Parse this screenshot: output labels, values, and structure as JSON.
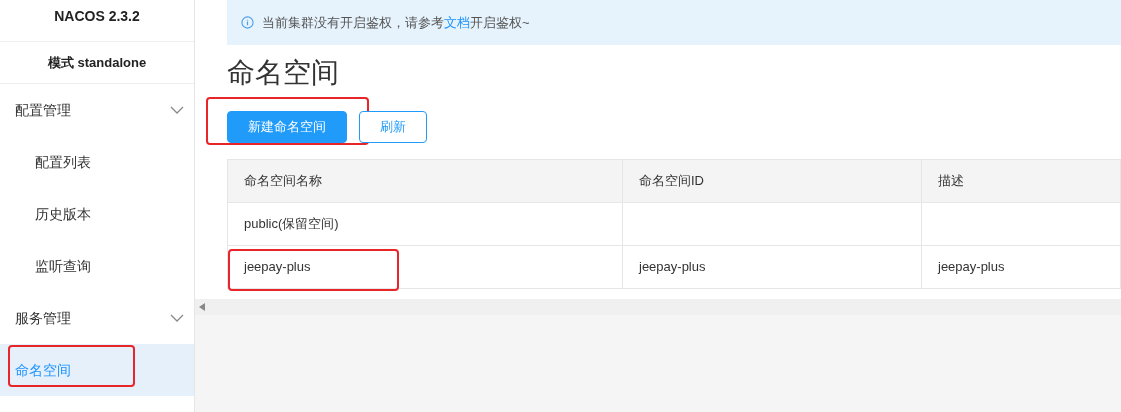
{
  "sidebar": {
    "title": "NACOS 2.3.2",
    "mode": "模式 standalone",
    "groups": [
      {
        "label": "配置管理",
        "items": [
          {
            "label": "配置列表",
            "selected": false,
            "highlighted": false
          },
          {
            "label": "历史版本",
            "selected": false,
            "highlighted": false
          },
          {
            "label": "监听查询",
            "selected": false,
            "highlighted": false
          }
        ]
      },
      {
        "label": "服务管理"
      }
    ],
    "bottom_items": [
      {
        "label": "命名空间",
        "selected": true,
        "highlighted": true
      }
    ]
  },
  "alert": {
    "before": "当前集群没有开启鉴权，请参考",
    "link": "文档",
    "after": "开启鉴权~"
  },
  "page_title": "命名空间",
  "actions": [
    {
      "label": "新建命名空间",
      "kind": "primary",
      "highlighted": true
    },
    {
      "label": "刷新",
      "kind": "secondary",
      "highlighted": false
    }
  ],
  "table": {
    "columns": [
      "命名空间名称",
      "命名空间ID",
      "描述"
    ],
    "rows": [
      {
        "cells": [
          {
            "text": "public(保留空间)",
            "highlighted": false
          },
          {
            "highlighted": false
          },
          {
            "highlighted": false
          }
        ]
      },
      {
        "cells": [
          {
            "text": "jeepay-plus",
            "highlighted": true
          },
          {
            "text": "jeepay-plus",
            "highlighted": false
          },
          {
            "text": "jeepay-plus",
            "highlighted": false
          }
        ]
      }
    ]
  }
}
